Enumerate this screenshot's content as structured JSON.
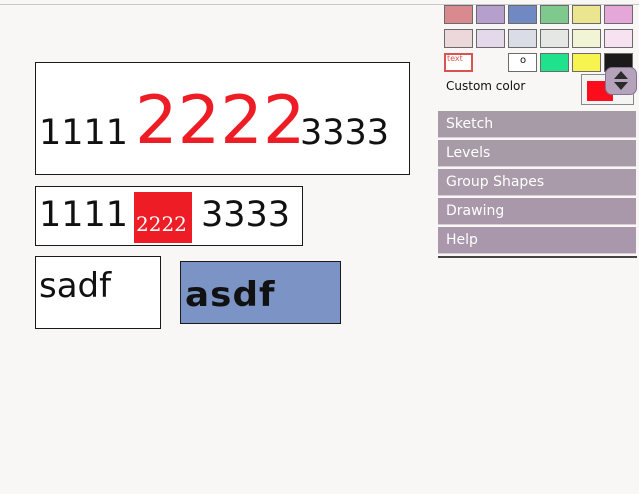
{
  "canvas": {
    "box1": {
      "left": "1111",
      "mid": "2222",
      "right": "3333"
    },
    "box2": {
      "left": "1111",
      "mid": "2222",
      "right": "3333"
    },
    "box3": {
      "text": "sadf"
    },
    "box4": {
      "text": "asdf"
    }
  },
  "palette": {
    "row1": [
      "#d98a8e",
      "#b59fcd",
      "#7189c2",
      "#7fc98f",
      "#ece58f",
      "#e4a7d8"
    ],
    "row2": [
      "#ecd8da",
      "#e3d9ea",
      "#dadde6",
      "#e4e7e4",
      "#f2f4d6",
      "#f6e2f1"
    ],
    "row3": [
      {
        "type": "text",
        "label": "text"
      },
      {
        "type": "dot",
        "label": "o"
      },
      {
        "color": "#1fe28c"
      },
      {
        "color": "#f7f44f"
      },
      {
        "color": "#1a1a1a"
      }
    ],
    "custom_label": "Custom color",
    "custom_color": "#fb0d1b"
  },
  "menu": [
    {
      "label": "Sketch",
      "color": "#a79ba7"
    },
    {
      "label": "Levels",
      "color": "#a79ba8"
    },
    {
      "label": "Group Shapes",
      "color": "#a99ba9"
    },
    {
      "label": "Drawing",
      "color": "#a998aa"
    },
    {
      "label": "Help",
      "color": "#a997ab"
    }
  ]
}
